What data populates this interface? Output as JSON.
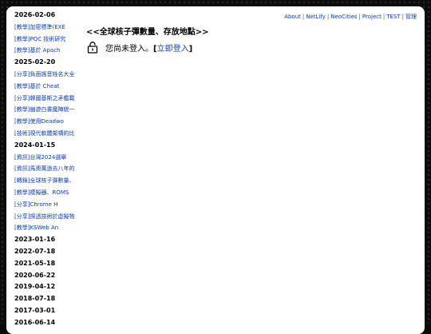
{
  "topnav": {
    "items": [
      "About",
      "NetLify",
      "NeoCities",
      "Project",
      "TEST",
      "管理"
    ],
    "separator": "|"
  },
  "heading": "<<全球核子彈數量、存放地點>>",
  "login": {
    "message": "您尚未登入。",
    "bracket_open": "[",
    "link": "立即登入",
    "bracket_close": "]"
  },
  "sidebar": {
    "groups": [
      {
        "date": "2026-02-06",
        "posts": [
          "[教學]加密標準(EXE",
          "[教學]PQC 技術研究",
          "[教學]基於 Apach"
        ]
      },
      {
        "date": "2025-02-20",
        "posts": [
          "[分享]負面謠音姓名大全",
          "[教學]基於 Cheat",
          "[分享]韓國基斯之矛艦載",
          "[教學]幽遊白書魔陣統一",
          "[教學]使用Deadwo",
          "[技術]現代軟體架構的比"
        ]
      },
      {
        "date": "2024-01-15",
        "posts": [
          "[資訊]台灣2024選舉",
          "[資訊]馬奧萬過去八年的",
          "[轉錄]全球核子彈數量、",
          "[教學]模擬器、ROMS",
          "[分享]Chrome H",
          "[分享]探透技術於虛擬物",
          "[教學]KSWeb An"
        ]
      },
      {
        "date": "2023-01-16",
        "posts": []
      },
      {
        "date": "2022-07-18",
        "posts": []
      },
      {
        "date": "2021-05-18",
        "posts": []
      },
      {
        "date": "2020-06-22",
        "posts": []
      },
      {
        "date": "2019-04-12",
        "posts": []
      },
      {
        "date": "2018-07-18",
        "posts": []
      },
      {
        "date": "2017-03-01",
        "posts": []
      },
      {
        "date": "2016-06-14",
        "posts": []
      }
    ]
  },
  "colors": {
    "link": "#0a3fbf",
    "frame": "#ffffff",
    "background": "#0c0c0c"
  },
  "icons": {
    "login": "lock-icon"
  }
}
